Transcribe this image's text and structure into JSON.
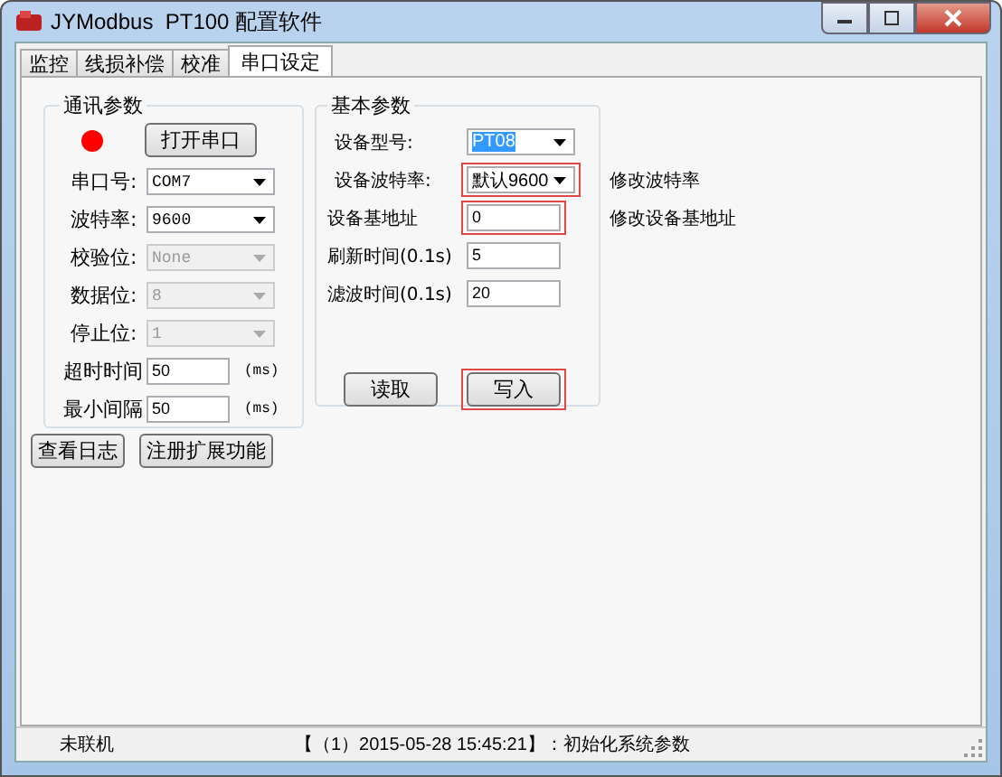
{
  "window": {
    "title": "JYModbus  PT100 配置软件"
  },
  "tabs": [
    {
      "label": "监控",
      "selected": false
    },
    {
      "label": "线损补偿",
      "selected": false
    },
    {
      "label": "校准",
      "selected": false
    },
    {
      "label": "串口设定",
      "selected": true
    }
  ],
  "comm": {
    "title": "通讯参数",
    "connected": false,
    "open_button": "打开串口",
    "fields": [
      {
        "label": "串口号:",
        "kind": "select",
        "value": "COM7",
        "disabled": false
      },
      {
        "label": "波特率:",
        "kind": "select",
        "value": "9600",
        "disabled": false
      },
      {
        "label": "校验位:",
        "kind": "select",
        "value": "None",
        "disabled": true
      },
      {
        "label": "数据位:",
        "kind": "select",
        "value": "8",
        "disabled": true
      },
      {
        "label": "停止位:",
        "kind": "select",
        "value": "1",
        "disabled": true
      },
      {
        "label": "超时时间",
        "kind": "input",
        "value": "50",
        "unit": "(ms)"
      },
      {
        "label": "最小间隔",
        "kind": "input",
        "value": "50",
        "unit": "(ms)"
      }
    ]
  },
  "bottom_buttons": [
    "查看日志",
    "注册扩展功能"
  ],
  "basic": {
    "title": "基本参数",
    "fields": [
      {
        "label": "设备型号:",
        "kind": "select",
        "value": "PT08",
        "highlighted": false,
        "focused": true
      },
      {
        "label": "设备波特率:",
        "kind": "select",
        "value": "默认9600",
        "highlighted": true,
        "note": "修改波特率"
      },
      {
        "label": "设备基地址",
        "kind": "input",
        "value": "0",
        "highlighted": true,
        "note": "修改设备基地址"
      },
      {
        "label": "刷新时间(0.1s)",
        "kind": "input",
        "value": "5",
        "highlighted": false
      },
      {
        "label": "滤波时间(0.1s)",
        "kind": "input",
        "value": "20",
        "highlighted": false
      }
    ],
    "buttons": [
      {
        "label": "读取",
        "highlighted": false
      },
      {
        "label": "写入",
        "highlighted": true
      }
    ]
  },
  "status_bar": {
    "connection": "未联机",
    "message": "【（1）2015-05-28 15:45:21】：初始化系统参数"
  }
}
